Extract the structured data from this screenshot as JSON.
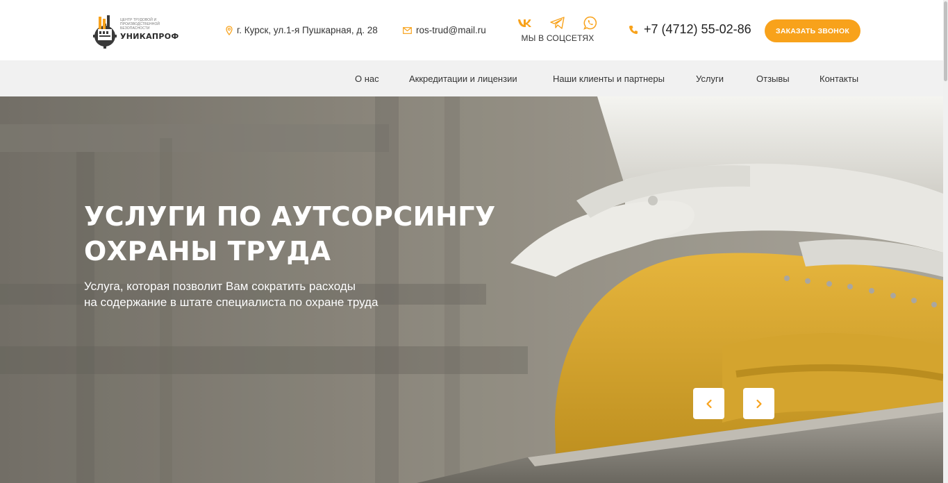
{
  "header": {
    "logo": {
      "small_text": "ЦЕНТР ТРУДОВОЙ И ПРОИЗВОДСТВЕННОЙ БЕЗОПАСНОСТИ",
      "name": "УНИКАПРОФ"
    },
    "address": "г. Курск, ул.1-я Пушкарная, д. 28",
    "email": "ros-trud@mail.ru",
    "social": {
      "label": "МЫ В СОЦСЕТЯХ",
      "icons": [
        "vk-icon",
        "telegram-icon",
        "whatsapp-icon"
      ]
    },
    "phone": "+7 (4712) 55-02-86",
    "callback_label": "ЗАКАЗАТЬ ЗВОНОК"
  },
  "nav": {
    "items": [
      "О нас",
      "Аккредитации и лицензии",
      "Наши клиенты и партнеры",
      "Услуги",
      "Отзывы",
      "Контакты"
    ]
  },
  "hero": {
    "title_line1": "УСЛУГИ ПО АУТСОРСИНГУ",
    "title_line2": "ОХРАНЫ ТРУДА",
    "subtitle_line1": "Услуга, которая позволит Вам сократить расходы",
    "subtitle_line2": "на содержание в штате специалиста по охране труда"
  },
  "colors": {
    "accent": "#f8a21b",
    "nav_bg": "#f1f1f1"
  }
}
